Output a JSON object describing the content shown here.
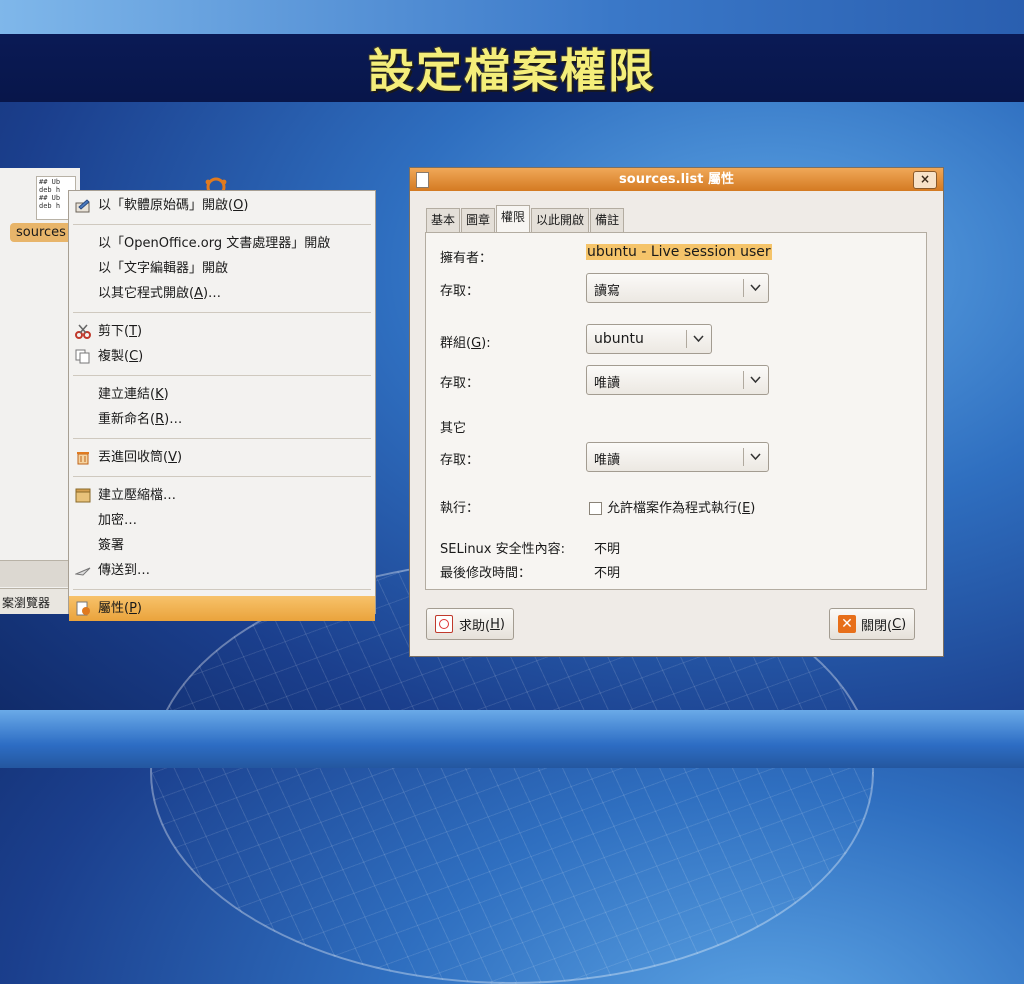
{
  "slide": {
    "title": "設定檔案權限"
  },
  "file_manager": {
    "file_label": "sources",
    "file_preview": "## Ub\ndeb h\n## Ub\ndeb h",
    "taskbar_label": "案瀏覽器"
  },
  "context_menu": {
    "items": [
      {
        "label": "以「軟體原始碼」開啟(",
        "key": "O",
        "tail": ")",
        "icon": "edit-icon"
      },
      {
        "label": "以「OpenOffice.org 文書處理器」開啟",
        "key": "",
        "tail": ""
      },
      {
        "label": "以「文字編輯器」開啟",
        "key": "",
        "tail": ""
      },
      {
        "label": "以其它程式開啟(",
        "key": "A",
        "tail": ")…"
      },
      {
        "label": "剪下(",
        "key": "T",
        "tail": ")",
        "icon": "scissors-icon"
      },
      {
        "label": "複製(",
        "key": "C",
        "tail": ")",
        "icon": "copy-icon"
      },
      {
        "label": "建立連結(",
        "key": "K",
        "tail": ")"
      },
      {
        "label": "重新命名(",
        "key": "R",
        "tail": ")…"
      },
      {
        "label": "丟進回收筒(",
        "key": "V",
        "tail": ")",
        "icon": "trash-icon"
      },
      {
        "label": "建立壓縮檔…",
        "key": "",
        "tail": "",
        "icon": "archive-icon"
      },
      {
        "label": "加密…",
        "key": "",
        "tail": ""
      },
      {
        "label": "簽署",
        "key": "",
        "tail": ""
      },
      {
        "label": "傳送到…",
        "key": "",
        "tail": "",
        "icon": "send-icon"
      },
      {
        "label": "屬性(",
        "key": "P",
        "tail": ")",
        "icon": "properties-icon"
      }
    ],
    "selected_index": 13
  },
  "dialog": {
    "title": "sources.list 屬性",
    "close_glyph": "×",
    "tabs": [
      "基本",
      "圖章",
      "權限",
      "以此開啟",
      "備註"
    ],
    "active_tab": "權限",
    "owner_label": "擁有者：",
    "owner_value": "ubuntu - Live session user",
    "owner_access_label": "存取：",
    "owner_access_value": "讀寫",
    "group_label_pre": "群組(",
    "group_label_key": "G",
    "group_label_post": "):",
    "group_value": "ubuntu",
    "group_access_label": "存取：",
    "group_access_value": "唯讀",
    "others_label": "其它",
    "others_access_label": "存取：",
    "others_access_value": "唯讀",
    "execute_label": "執行：",
    "execute_checkbox_pre": "允許檔案作為程式執行(",
    "execute_checkbox_key": "E",
    "execute_checkbox_post": ")",
    "execute_checked": false,
    "selinux_label": "SELinux 安全性內容:",
    "selinux_value": "不明",
    "modified_label": "最後修改時間：",
    "modified_value": "不明",
    "help_button_pre": "求助(",
    "help_button_key": "H",
    "help_button_post": ")",
    "close_button_pre": "關閉(",
    "close_button_key": "C",
    "close_button_post": ")"
  },
  "colors": {
    "title_text": "#f4ee7a",
    "title_band": "#08164a",
    "dialog_titlebar": "#d47a22",
    "selection": "#eaa33c"
  }
}
